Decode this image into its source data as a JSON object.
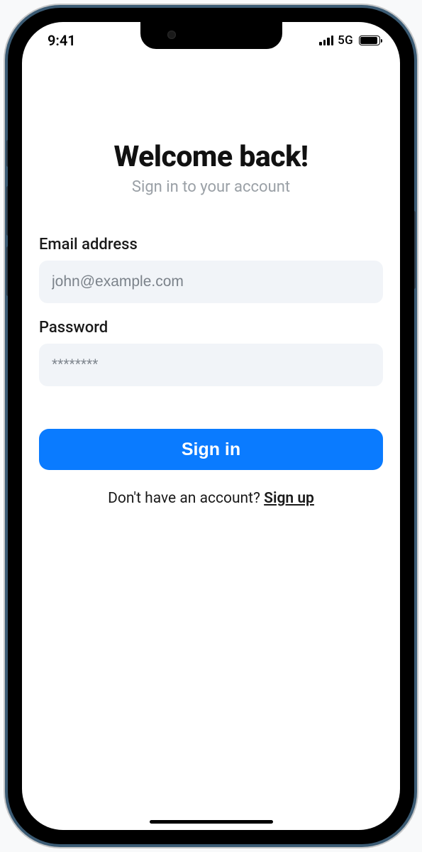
{
  "status": {
    "time": "9:41",
    "network_label": "5G"
  },
  "header": {
    "title": "Welcome back!",
    "subtitle": "Sign in to your account"
  },
  "form": {
    "email_label": "Email address",
    "email_placeholder": "john@example.com",
    "password_label": "Password",
    "password_placeholder": "********",
    "submit_label": "Sign in"
  },
  "footer": {
    "prompt": "Don't have an account? ",
    "link": "Sign up"
  },
  "colors": {
    "primary": "#0a7bff",
    "input_bg": "#f1f4f8",
    "muted_text": "#9aa0a6"
  }
}
